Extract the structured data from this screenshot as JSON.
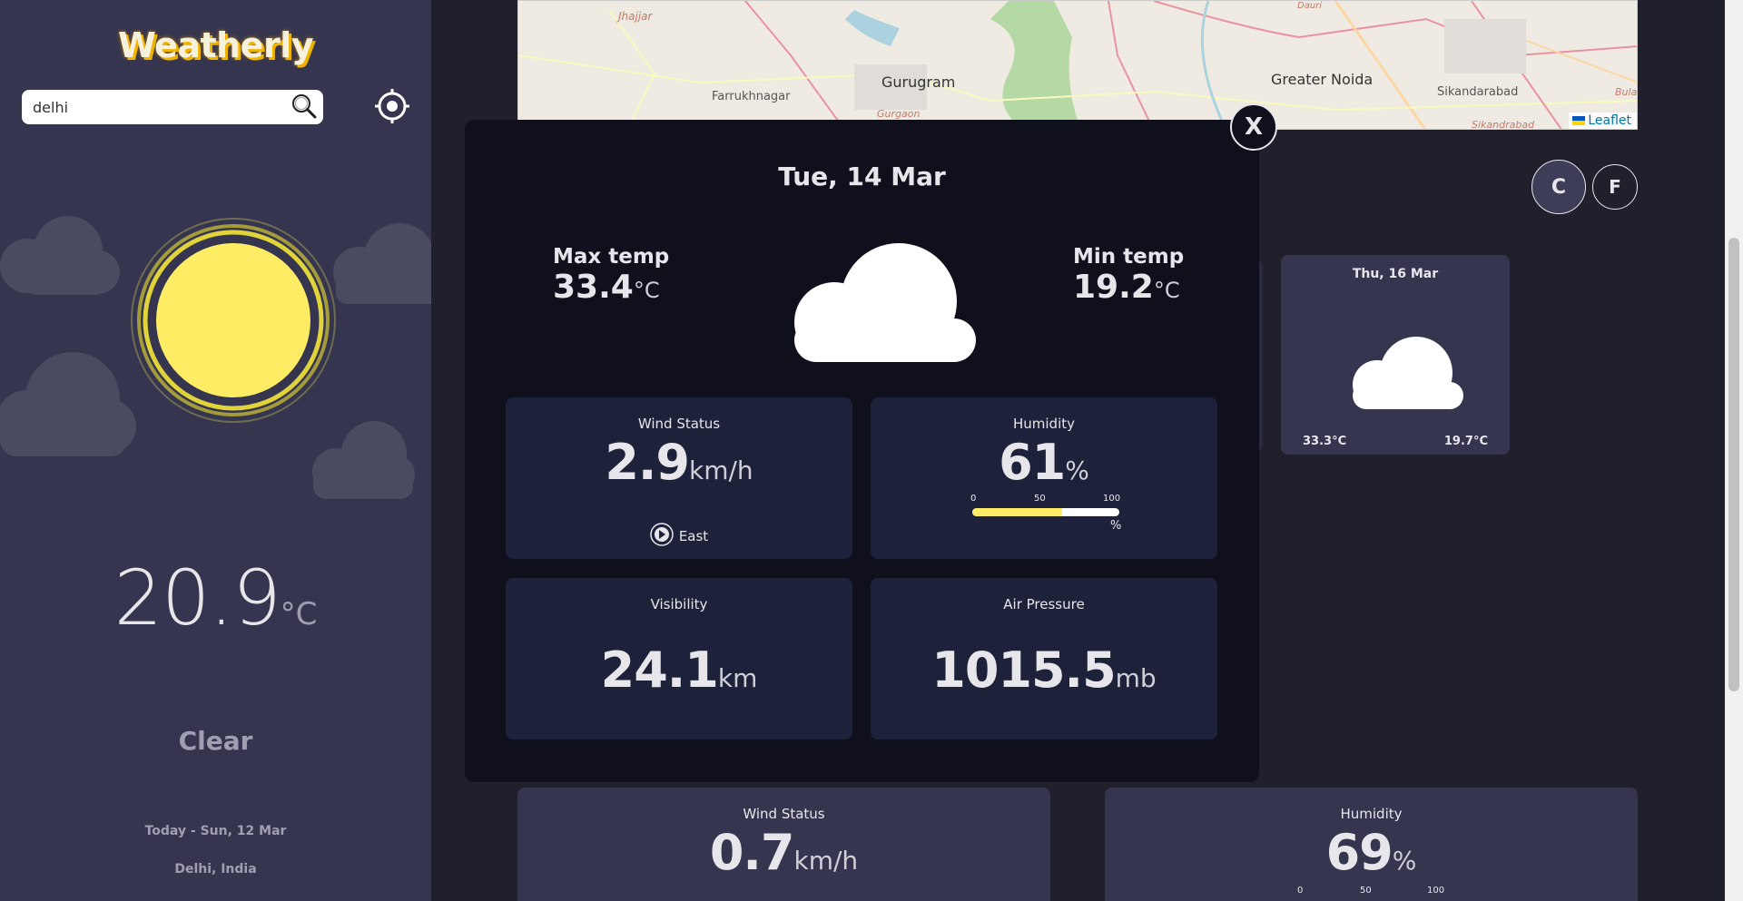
{
  "app": {
    "logo": "Weatherly"
  },
  "search": {
    "value": "delhi"
  },
  "current": {
    "temp": "20.9",
    "unit": "°C",
    "condition": "Clear",
    "date": "Today - Sun, 12 Mar",
    "location": "Delhi, India"
  },
  "map": {
    "labels": [
      "Jhajjar",
      "Farrukhnagar",
      "Gurugram",
      "Gurgaon",
      "Greater Noida",
      "Sikandarabad",
      "Sikandrabad",
      "Bula",
      "Dauri"
    ],
    "attribution": "Leaflet"
  },
  "units": {
    "c": "C",
    "f": "F"
  },
  "forecast": [
    {
      "date": "Thu, 16 Mar",
      "icon": "cloud-icon",
      "max": "33.3°C",
      "min": "19.7°C"
    }
  ],
  "highlights": {
    "wind": {
      "title": "Wind Status",
      "value": "0.7",
      "unit": "km/h"
    },
    "humidity": {
      "title": "Humidity",
      "value": "69",
      "unit": "%",
      "scale": [
        "0",
        "50",
        "100"
      ]
    }
  },
  "modal": {
    "close": "X",
    "date": "Tue, 14 Mar",
    "max_label": "Max temp",
    "max_value": "33.4",
    "min_label": "Min temp",
    "min_value": "19.2",
    "temp_unit": "°C",
    "icon": "cloud-icon",
    "wind": {
      "title": "Wind Status",
      "value": "2.9",
      "unit": "km/h",
      "direction": "East"
    },
    "humidity": {
      "title": "Humidity",
      "value": "61",
      "unit": "%",
      "scale": [
        "0",
        "50",
        "100"
      ],
      "scale_unit": "%",
      "level": 0.61
    },
    "visibility": {
      "title": "Visibility",
      "value": "24.1",
      "unit": "km"
    },
    "pressure": {
      "title": "Air Pressure",
      "value": "1015.5",
      "unit": "mb"
    }
  },
  "colors": {
    "sidebar": "#363550",
    "background": "#201f2c",
    "modal": "#100f1c",
    "card": "#1e213a",
    "sun": "#ffec65",
    "humidity_bar": "#ffec65"
  }
}
